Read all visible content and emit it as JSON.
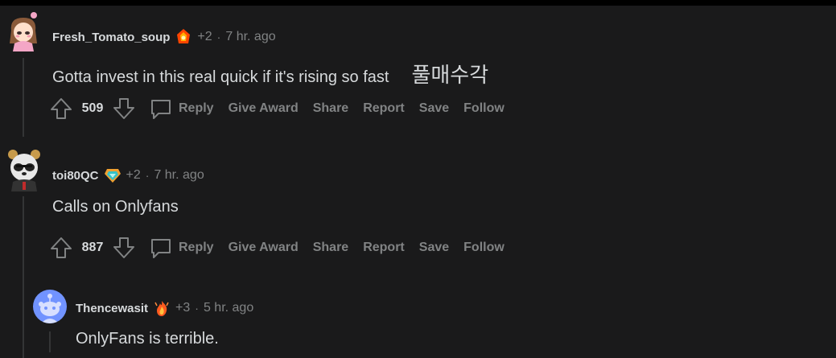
{
  "comments": [
    {
      "author": "Fresh_Tomato_soup",
      "karma_delta": "+2",
      "separator": "·",
      "time": "7 hr. ago",
      "body": "Gotta invest in this real quick if it's rising so fast",
      "body_extra": "풀매수각",
      "votes": "509",
      "avatar_icon": "pink-haired-girl-avatar-icon",
      "flair_icon": "fire-award-icon"
    },
    {
      "author": "toi80QC",
      "karma_delta": "+2",
      "separator": "·",
      "time": "7 hr. ago",
      "body": "Calls on Onlyfans",
      "votes": "887",
      "avatar_icon": "panda-bear-avatar-icon",
      "flair_icon": "gem-award-icon"
    },
    {
      "author": "Thencewasit",
      "karma_delta": "+3",
      "separator": "·",
      "time": "5 hr. ago",
      "body": "OnlyFans is terrible.",
      "avatar_icon": "default-snoo-avatar-icon",
      "flair_icon": "flame-award-icon"
    }
  ],
  "actions": {
    "reply": "Reply",
    "give_award": "Give Award",
    "share": "Share",
    "report": "Report",
    "save": "Save",
    "follow": "Follow"
  },
  "colors": {
    "background": "#1a1a1b",
    "text": "#d7dadc",
    "muted": "#818384",
    "thread_line": "#343536",
    "snoo_blue": "#7193ff"
  }
}
